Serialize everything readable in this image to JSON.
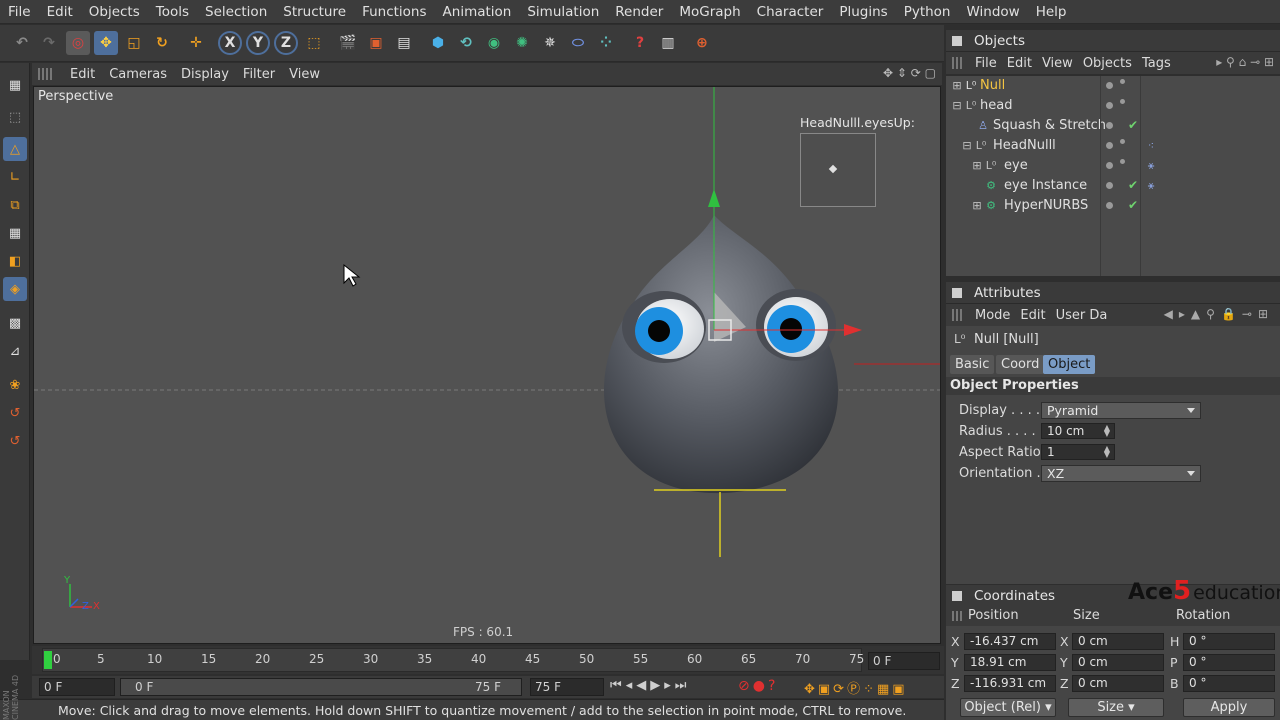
{
  "menubar": [
    "File",
    "Edit",
    "Objects",
    "Tools",
    "Selection",
    "Structure",
    "Functions",
    "Animation",
    "Simulation",
    "Render",
    "MoGraph",
    "Character",
    "Plugins",
    "Python",
    "Window",
    "Help"
  ],
  "toolbar": {
    "axes": [
      "X",
      "Y",
      "Z"
    ]
  },
  "viewport": {
    "menu": [
      "Edit",
      "Cameras",
      "Display",
      "Filter",
      "View"
    ],
    "label": "Perspective",
    "fps": "FPS : 60.1",
    "inset_label": "HeadNulll.eyesUp:",
    "axis_y": "Y",
    "axis_z": "Z",
    "axis_x": "X"
  },
  "timeline": {
    "ticks": [
      "0",
      "5",
      "10",
      "15",
      "20",
      "25",
      "30",
      "35",
      "40",
      "45",
      "50",
      "55",
      "60",
      "65",
      "70",
      "75"
    ],
    "current_frame": "0 F",
    "start_field": "0 F",
    "range_start": "0 F",
    "range_end": "75 F",
    "end_field": "75 F"
  },
  "status": "Move: Click and drag to move elements. Hold down SHIFT to quantize movement / add to the selection in point mode, CTRL to remove.",
  "objects_panel": {
    "title": "Objects",
    "menu": [
      "File",
      "Edit",
      "View",
      "Objects",
      "Tags"
    ],
    "items": [
      {
        "name": "Null",
        "indent": 0,
        "selected": true,
        "tag": ""
      },
      {
        "name": "head",
        "indent": 0,
        "selected": false,
        "tag": ""
      },
      {
        "name": "Squash & Stretch",
        "indent": 1,
        "selected": false,
        "tag": "check"
      },
      {
        "name": "HeadNulll",
        "indent": 1,
        "selected": false,
        "tag": "xpresso"
      },
      {
        "name": "eye",
        "indent": 2,
        "selected": false,
        "tag": "pose"
      },
      {
        "name": "eye Instance",
        "indent": 2,
        "selected": false,
        "tag": "check-pose"
      },
      {
        "name": "HyperNURBS",
        "indent": 2,
        "selected": false,
        "tag": "check"
      }
    ]
  },
  "attributes_panel": {
    "title": "Attributes",
    "menu": [
      "Mode",
      "Edit",
      "User Da"
    ],
    "object_name": "Null [Null]",
    "tabs": [
      "Basic",
      "Coord",
      "Object"
    ],
    "active_tab": "Object",
    "section": "Object Properties",
    "props": {
      "display_label": "Display . . . . .",
      "display_value": "Pyramid",
      "radius_label": "Radius . . . . .",
      "radius_value": "10 cm",
      "aspect_label": "Aspect Ratio",
      "aspect_value": "1",
      "orientation_label": "Orientation . .",
      "orientation_value": "XZ"
    }
  },
  "coordinates_panel": {
    "title": "Coordinates",
    "headers": [
      "Position",
      "Size",
      "Rotation"
    ],
    "rows": [
      {
        "p_axis": "X",
        "p_val": "-16.437 cm",
        "s_axis": "X",
        "s_val": "0 cm",
        "r_axis": "H",
        "r_val": "0 °"
      },
      {
        "p_axis": "Y",
        "p_val": "18.91 cm",
        "s_axis": "Y",
        "s_val": "0 cm",
        "r_axis": "P",
        "r_val": "0 °"
      },
      {
        "p_axis": "Z",
        "p_val": "-116.931 cm",
        "s_axis": "Z",
        "s_val": "0 cm",
        "r_axis": "B",
        "r_val": "0 °"
      }
    ],
    "mode_dropdown": "Object (Rel)",
    "size_dropdown": "Size",
    "apply_label": "Apply"
  },
  "watermark": {
    "brand": "Ace",
    "num": "5",
    "suffix": "education"
  },
  "side_logo": "MAXON CINEMA 4D",
  "colors": {
    "accent": "#7a9cc6",
    "selected": "#f4c542",
    "check": "#6fd36f",
    "eye_iris": "#1e8fe0"
  }
}
